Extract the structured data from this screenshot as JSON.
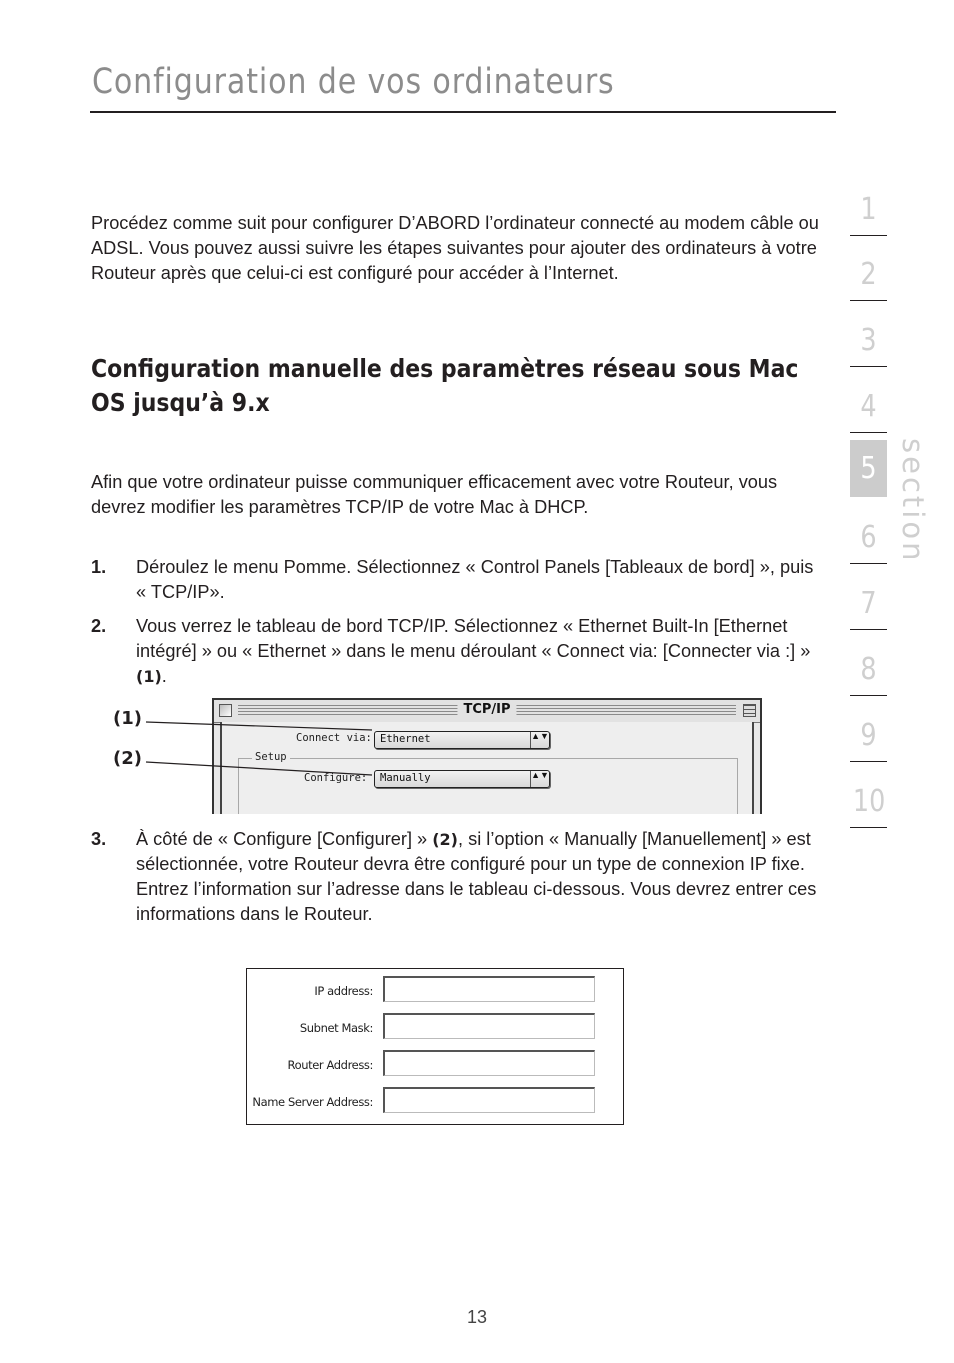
{
  "header": {
    "title": "Configuration de vos ordinateurs"
  },
  "intro": "Procédez comme suit pour configurer D’ABORD l’ordinateur connecté au modem câble ou ADSL. Vous pouvez aussi suivre les étapes suivantes pour ajouter des ordinateurs à votre Routeur après que celui-ci est configuré pour accéder à l’Internet.",
  "subheading": "Configuration manuelle des paramètres réseau sous Mac OS jusqu’à 9.x",
  "paragraph2": "Afin que votre ordinateur puisse communiquer efficacement avec votre Routeur, vous devrez modifier les paramètres TCP/IP de votre Mac à DHCP.",
  "steps": [
    {
      "number": "1.",
      "text": "Déroulez le menu Pomme. Sélectionnez « Control Panels [Tableaux de bord] », puis « TCP/IP».",
      "ref": "",
      "tail": ""
    },
    {
      "number": "2.",
      "text": "Vous verrez le tableau de bord TCP/IP. Sélectionnez « Ethernet Built-In [Ethernet intégré] » ou « Ethernet » dans le menu déroulant « Connect via: [Connecter via :] » ",
      "ref": "(1)",
      "tail": "."
    },
    {
      "number": "3.",
      "text_before": "À côté de « Configure [Configurer] » ",
      "ref": "(2)",
      "text_after": ", si l’option « Manually [Manuellement] » est sélectionnée, votre Routeur devra être configuré pour un type de connexion IP fixe. Entrez l’information sur l’adresse dans le tableau ci-dessous. Vous devrez entrer ces informations dans le Routeur."
    }
  ],
  "figure_tcpip": {
    "callouts": [
      "(1)",
      "(2)"
    ],
    "window_title": "TCP/IP",
    "connect_via_label": "Connect via:",
    "connect_via_value": "Ethernet",
    "setup_group_label": "Setup",
    "configure_label": "Configure:",
    "configure_value": "Manually",
    "popup_arrows": "▲▼"
  },
  "address_table": {
    "fields": [
      {
        "label": "IP address:",
        "value": ""
      },
      {
        "label": "Subnet Mask:",
        "value": ""
      },
      {
        "label": "Router Address:",
        "value": ""
      },
      {
        "label": "Name Server Address:",
        "value": ""
      }
    ]
  },
  "section_nav": {
    "items": [
      "1",
      "2",
      "3",
      "4",
      "5",
      "6",
      "7",
      "8",
      "9",
      "10"
    ],
    "active": "5",
    "word": "section"
  },
  "footer": {
    "page_number": "13"
  }
}
